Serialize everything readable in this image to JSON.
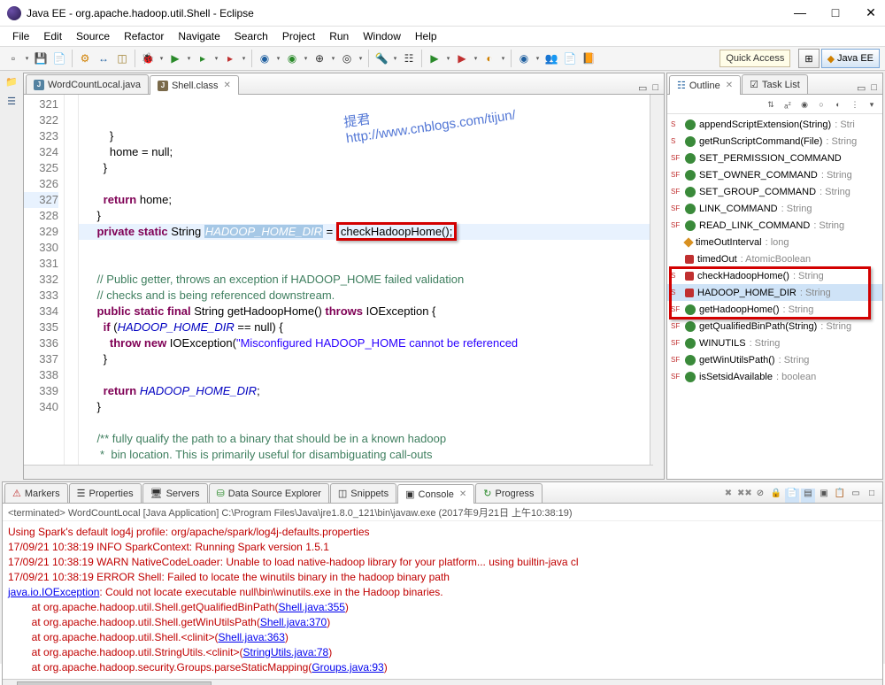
{
  "titlebar": {
    "title": "Java EE - org.apache.hadoop.util.Shell - Eclipse"
  },
  "menu": {
    "items": [
      "File",
      "Edit",
      "Source",
      "Refactor",
      "Navigate",
      "Search",
      "Project",
      "Run",
      "Window",
      "Help"
    ]
  },
  "quickAccess": {
    "label": "Quick Access"
  },
  "perspective": {
    "label": "Java EE"
  },
  "editorTabs": {
    "tab0": "WordCountLocal.java",
    "tab1": "Shell.class"
  },
  "outline": {
    "tab0": "Outline",
    "tab1": "Task List"
  },
  "code": {
    "lines": {
      "321": "        }",
      "322": "        home = null;",
      "323": "      }",
      "324": "",
      "325": "      return home;",
      "326": "    }",
      "327_pre": "    ",
      "327_kw1": "private static",
      "327_mid": " String ",
      "327_sel": "HADOOP_HOME_DIR",
      "327_eq": " = ",
      "327_box": "checkHadoopHome();",
      "328": "",
      "329": "    // Public getter, throws an exception if HADOOP_HOME failed validation",
      "330": "    // checks and is being referenced downstream.",
      "331_pre": "    ",
      "331_kw1": "public static final",
      "331_mid": " String getHadoopHome() ",
      "331_kw2": "throws",
      "331_end": " IOException {",
      "332_pre": "      ",
      "332_kw": "if",
      "332_mid": " (",
      "332_lit": "HADOOP_HOME_DIR",
      "332_end": " == null) {",
      "333_pre": "        ",
      "333_kw": "throw new",
      "333_mid": " IOException(",
      "333_str": "\"Misconfigured HADOOP_HOME cannot be referenced",
      "334": "      }",
      "335": "",
      "336_pre": "      ",
      "336_kw": "return",
      "336_sp": " ",
      "336_lit": "HADOOP_HOME_DIR",
      "336_end": ";",
      "337": "    }",
      "338": "",
      "339": "    /** fully qualify the path to a binary that should be in a known hadoop",
      "340": "     *  bin location. This is primarily useful for disambiguating call-outs"
    },
    "linenums": [
      "321",
      "322",
      "323",
      "324",
      "325",
      "326",
      "327",
      "328",
      "329",
      "330",
      "331",
      "332",
      "333",
      "334",
      "335",
      "336",
      "337",
      "338",
      "339",
      "340"
    ],
    "watermark_line1": "提君",
    "watermark_line2": "http://www.cnblogs.com/tijun/"
  },
  "outlineItems": [
    {
      "sf": "S",
      "ico": "green",
      "name": "appendScriptExtension(String)",
      "type": " : Stri"
    },
    {
      "sf": "S",
      "ico": "green",
      "name": "getRunScriptCommand(File)",
      "type": " : String"
    },
    {
      "sf": "SF",
      "ico": "green",
      "name": "SET_PERMISSION_COMMAND",
      "type": ""
    },
    {
      "sf": "SF",
      "ico": "green",
      "name": "SET_OWNER_COMMAND",
      "type": " : String"
    },
    {
      "sf": "SF",
      "ico": "green",
      "name": "SET_GROUP_COMMAND",
      "type": " : String"
    },
    {
      "sf": "SF",
      "ico": "green",
      "name": "LINK_COMMAND",
      "type": " : String"
    },
    {
      "sf": "SF",
      "ico": "green",
      "name": "READ_LINK_COMMAND",
      "type": " : String"
    },
    {
      "sf": "",
      "ico": "orange",
      "name": "timeOutInterval",
      "type": " : long"
    },
    {
      "sf": "",
      "ico": "red",
      "name": "timedOut",
      "type": " : AtomicBoolean"
    },
    {
      "sf": "S",
      "ico": "red",
      "name": "checkHadoopHome()",
      "type": " : String"
    },
    {
      "sf": "S",
      "ico": "red",
      "name": "HADOOP_HOME_DIR",
      "type": " : String"
    },
    {
      "sf": "SF",
      "ico": "green",
      "name": "getHadoopHome()",
      "type": " : String"
    },
    {
      "sf": "SF",
      "ico": "green",
      "name": "getQualifiedBinPath(String)",
      "type": " : String"
    },
    {
      "sf": "SF",
      "ico": "green",
      "name": "WINUTILS",
      "type": " : String"
    },
    {
      "sf": "SF",
      "ico": "green",
      "name": "getWinUtilsPath()",
      "type": " : String"
    },
    {
      "sf": "SF",
      "ico": "green",
      "name": "isSetsidAvailable",
      "type": " : boolean"
    }
  ],
  "lowerTabs": [
    "Markers",
    "Properties",
    "Servers",
    "Data Source Explorer",
    "Snippets",
    "Console",
    "Progress"
  ],
  "console": {
    "header": "<terminated> WordCountLocal [Java Application] C:\\Program Files\\Java\\jre1.8.0_121\\bin\\javaw.exe (2017年9月21日 上午10:38:19)",
    "l1": "Using Spark's default log4j profile: org/apache/spark/log4j-defaults.properties",
    "l2": "17/09/21 10:38:19 INFO SparkContext: Running Spark version 1.5.1",
    "l3": "17/09/21 10:38:19 WARN NativeCodeLoader: Unable to load native-hadoop library for your platform... using builtin-java cl",
    "l4": "17/09/21 10:38:19 ERROR Shell: Failed to locate the winutils binary in the hadoop binary path",
    "l5a": "java.io.IOException",
    "l5b": ": Could not locate executable null\\bin\\winutils.exe in the Hadoop binaries.",
    "l6a": "        at org.apache.hadoop.util.Shell.getQualifiedBinPath(",
    "l6b": "Shell.java:355",
    "l6c": ")",
    "l7a": "        at org.apache.hadoop.util.Shell.getWinUtilsPath(",
    "l7b": "Shell.java:370",
    "l7c": ")",
    "l8a": "        at org.apache.hadoop.util.Shell.<clinit>(",
    "l8b": "Shell.java:363",
    "l8c": ")",
    "l9a": "        at org.apache.hadoop.util.StringUtils.<clinit>(",
    "l9b": "StringUtils.java:78",
    "l9c": ")",
    "l10a": "        at org.apache.hadoop.security.Groups.parseStaticMapping(",
    "l10b": "Groups.java:93",
    "l10c": ")"
  }
}
